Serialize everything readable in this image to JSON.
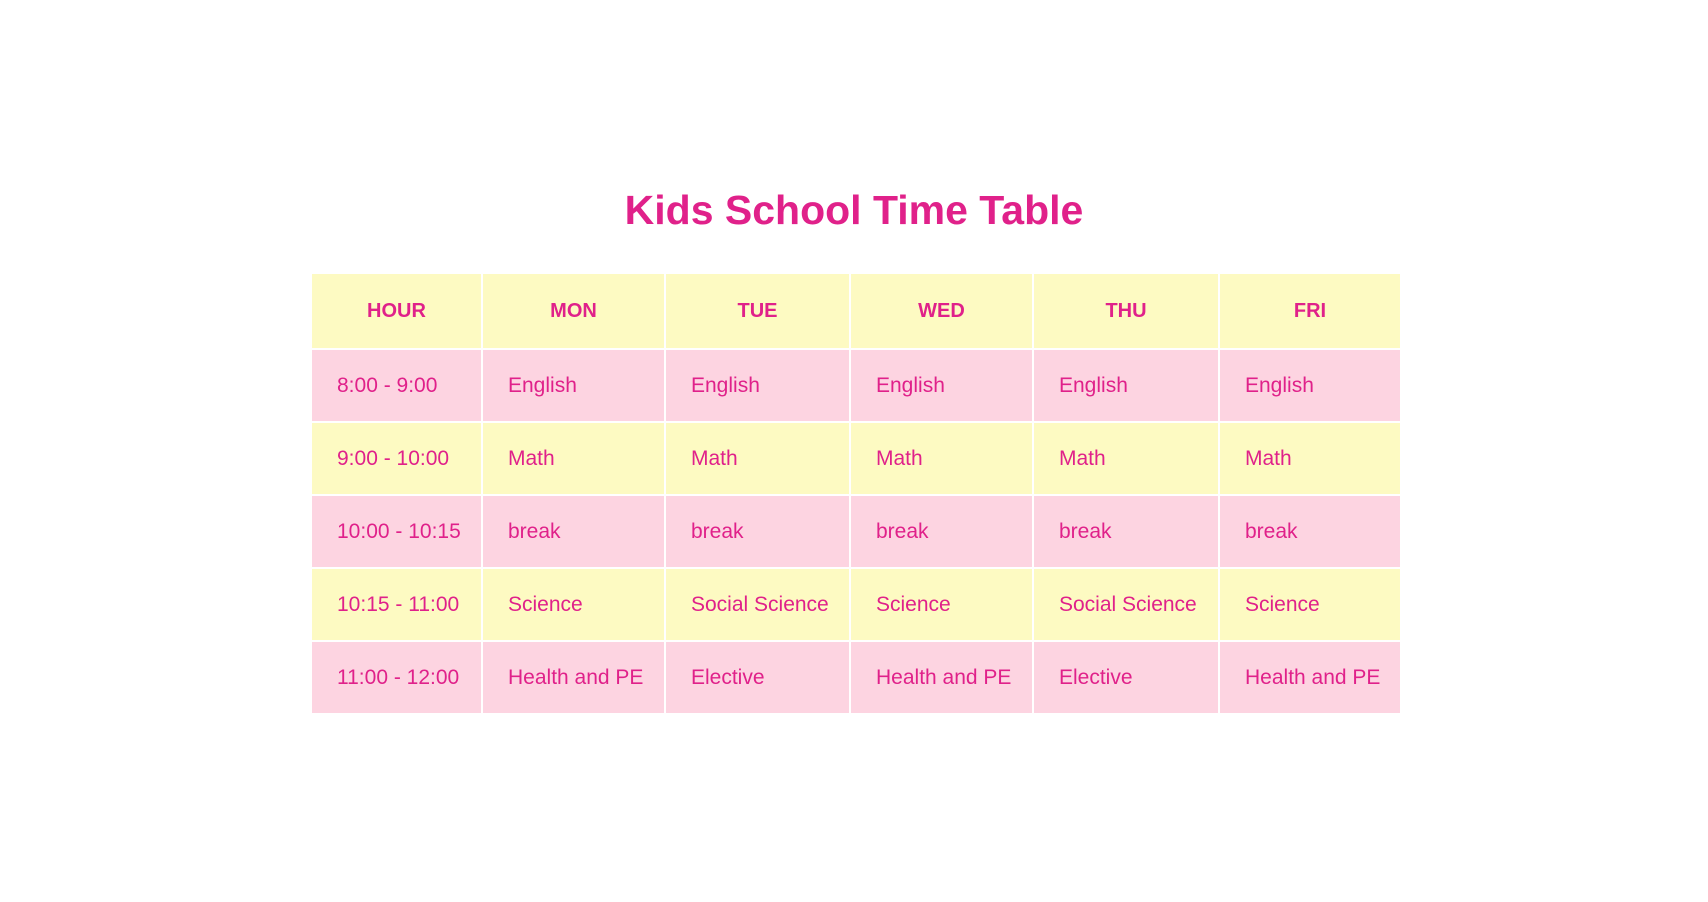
{
  "title": "Kids School Time Table",
  "table": {
    "headers": [
      "HOUR",
      "MON",
      "TUE",
      "WED",
      "THU",
      "FRI"
    ],
    "rows": [
      {
        "style": "pink",
        "cells": [
          "8:00 - 9:00",
          "English",
          "English",
          "English",
          "English",
          "English"
        ]
      },
      {
        "style": "yellow",
        "cells": [
          "9:00 - 10:00",
          "Math",
          "Math",
          "Math",
          "Math",
          "Math"
        ]
      },
      {
        "style": "pink",
        "cells": [
          "10:00 - 10:15",
          "break",
          "break",
          "break",
          "break",
          "break"
        ]
      },
      {
        "style": "yellow",
        "cells": [
          "10:15 - 11:00",
          "Science",
          "Social Science",
          "Science",
          "Social Science",
          "Science"
        ]
      },
      {
        "style": "pink",
        "cells": [
          "11:00 - 12:00",
          "Health and PE",
          "Elective",
          "Health and PE",
          "Elective",
          "Health and PE"
        ]
      }
    ]
  },
  "colors": {
    "accent_text": "#e0218a",
    "header_bg": "#fdfac2",
    "pink_row_bg": "#fdd4e1",
    "yellow_row_bg": "#fdfac2",
    "page_bg": "#ffffff"
  }
}
